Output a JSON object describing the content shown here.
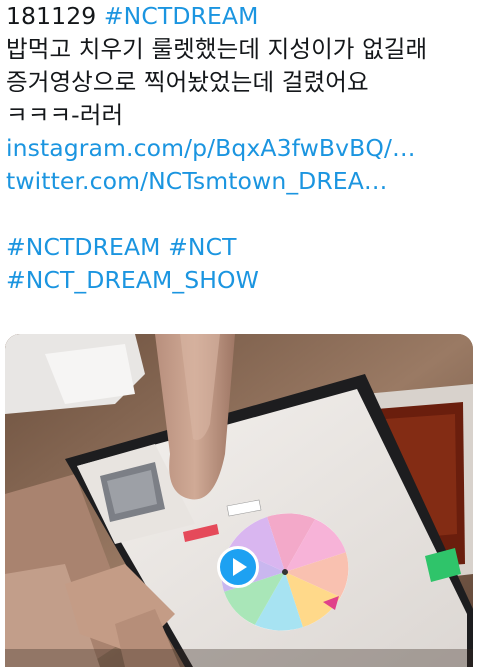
{
  "tweet": {
    "lines": [
      {
        "plain": "181129 ",
        "tag": "#NCTDREAM"
      },
      {
        "text": "밥먹고 치우기 룰렛했는데 지성이가 없길래"
      },
      {
        "text": "증거영상으로 찍어놨었는데 걸렸어요"
      },
      {
        "text": "ㅋㅋㅋ-러러"
      }
    ],
    "links": [
      "instagram.com/p/BqxA3fwBvBQ/…",
      "twitter.com/NCTsmtown_DREA…"
    ],
    "hashtags_line1": [
      "#NCTDREAM",
      "#NCT"
    ],
    "hashtags_line2": "#NCT_DREAM_SHOW"
  },
  "media": {
    "type": "video",
    "play_icon": "play-icon"
  },
  "colors": {
    "link": "#1b95e0",
    "text": "#14171a",
    "play_button": "#1da1f2"
  }
}
